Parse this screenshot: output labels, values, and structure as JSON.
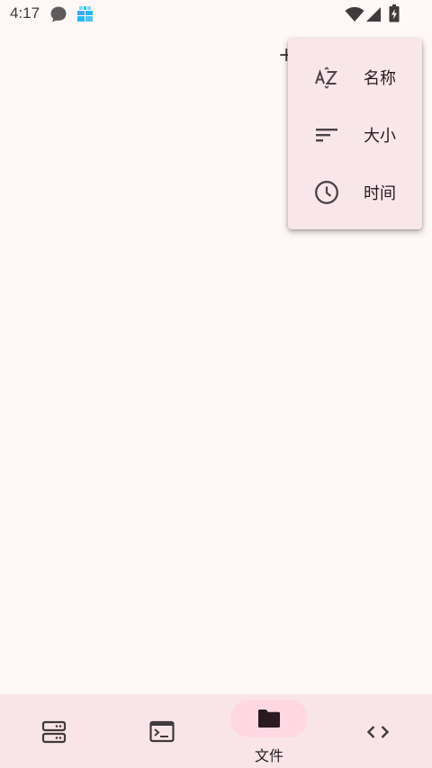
{
  "status_bar": {
    "time": "4:17",
    "icons": [
      "chat-bubble-icon",
      "gift-app-icon",
      "wifi-icon",
      "cell-signal-icon",
      "battery-charging-icon"
    ]
  },
  "sort_menu": {
    "items": [
      {
        "label": "名称",
        "icon": "sort-alpha-icon"
      },
      {
        "label": "大小",
        "icon": "sort-lines-icon"
      },
      {
        "label": "时间",
        "icon": "clock-icon"
      }
    ]
  },
  "bottom_nav": {
    "items": [
      {
        "icon": "server-icon",
        "label": ""
      },
      {
        "icon": "terminal-icon",
        "label": ""
      },
      {
        "icon": "folder-icon",
        "label": "文件",
        "active": true
      },
      {
        "icon": "code-icon",
        "label": ""
      }
    ]
  },
  "colors": {
    "background": "#FFF8F7",
    "menu_surface": "#F9E6EA",
    "nav_surface": "#F9E5E9",
    "active_indicator": "#FFD8E3"
  }
}
